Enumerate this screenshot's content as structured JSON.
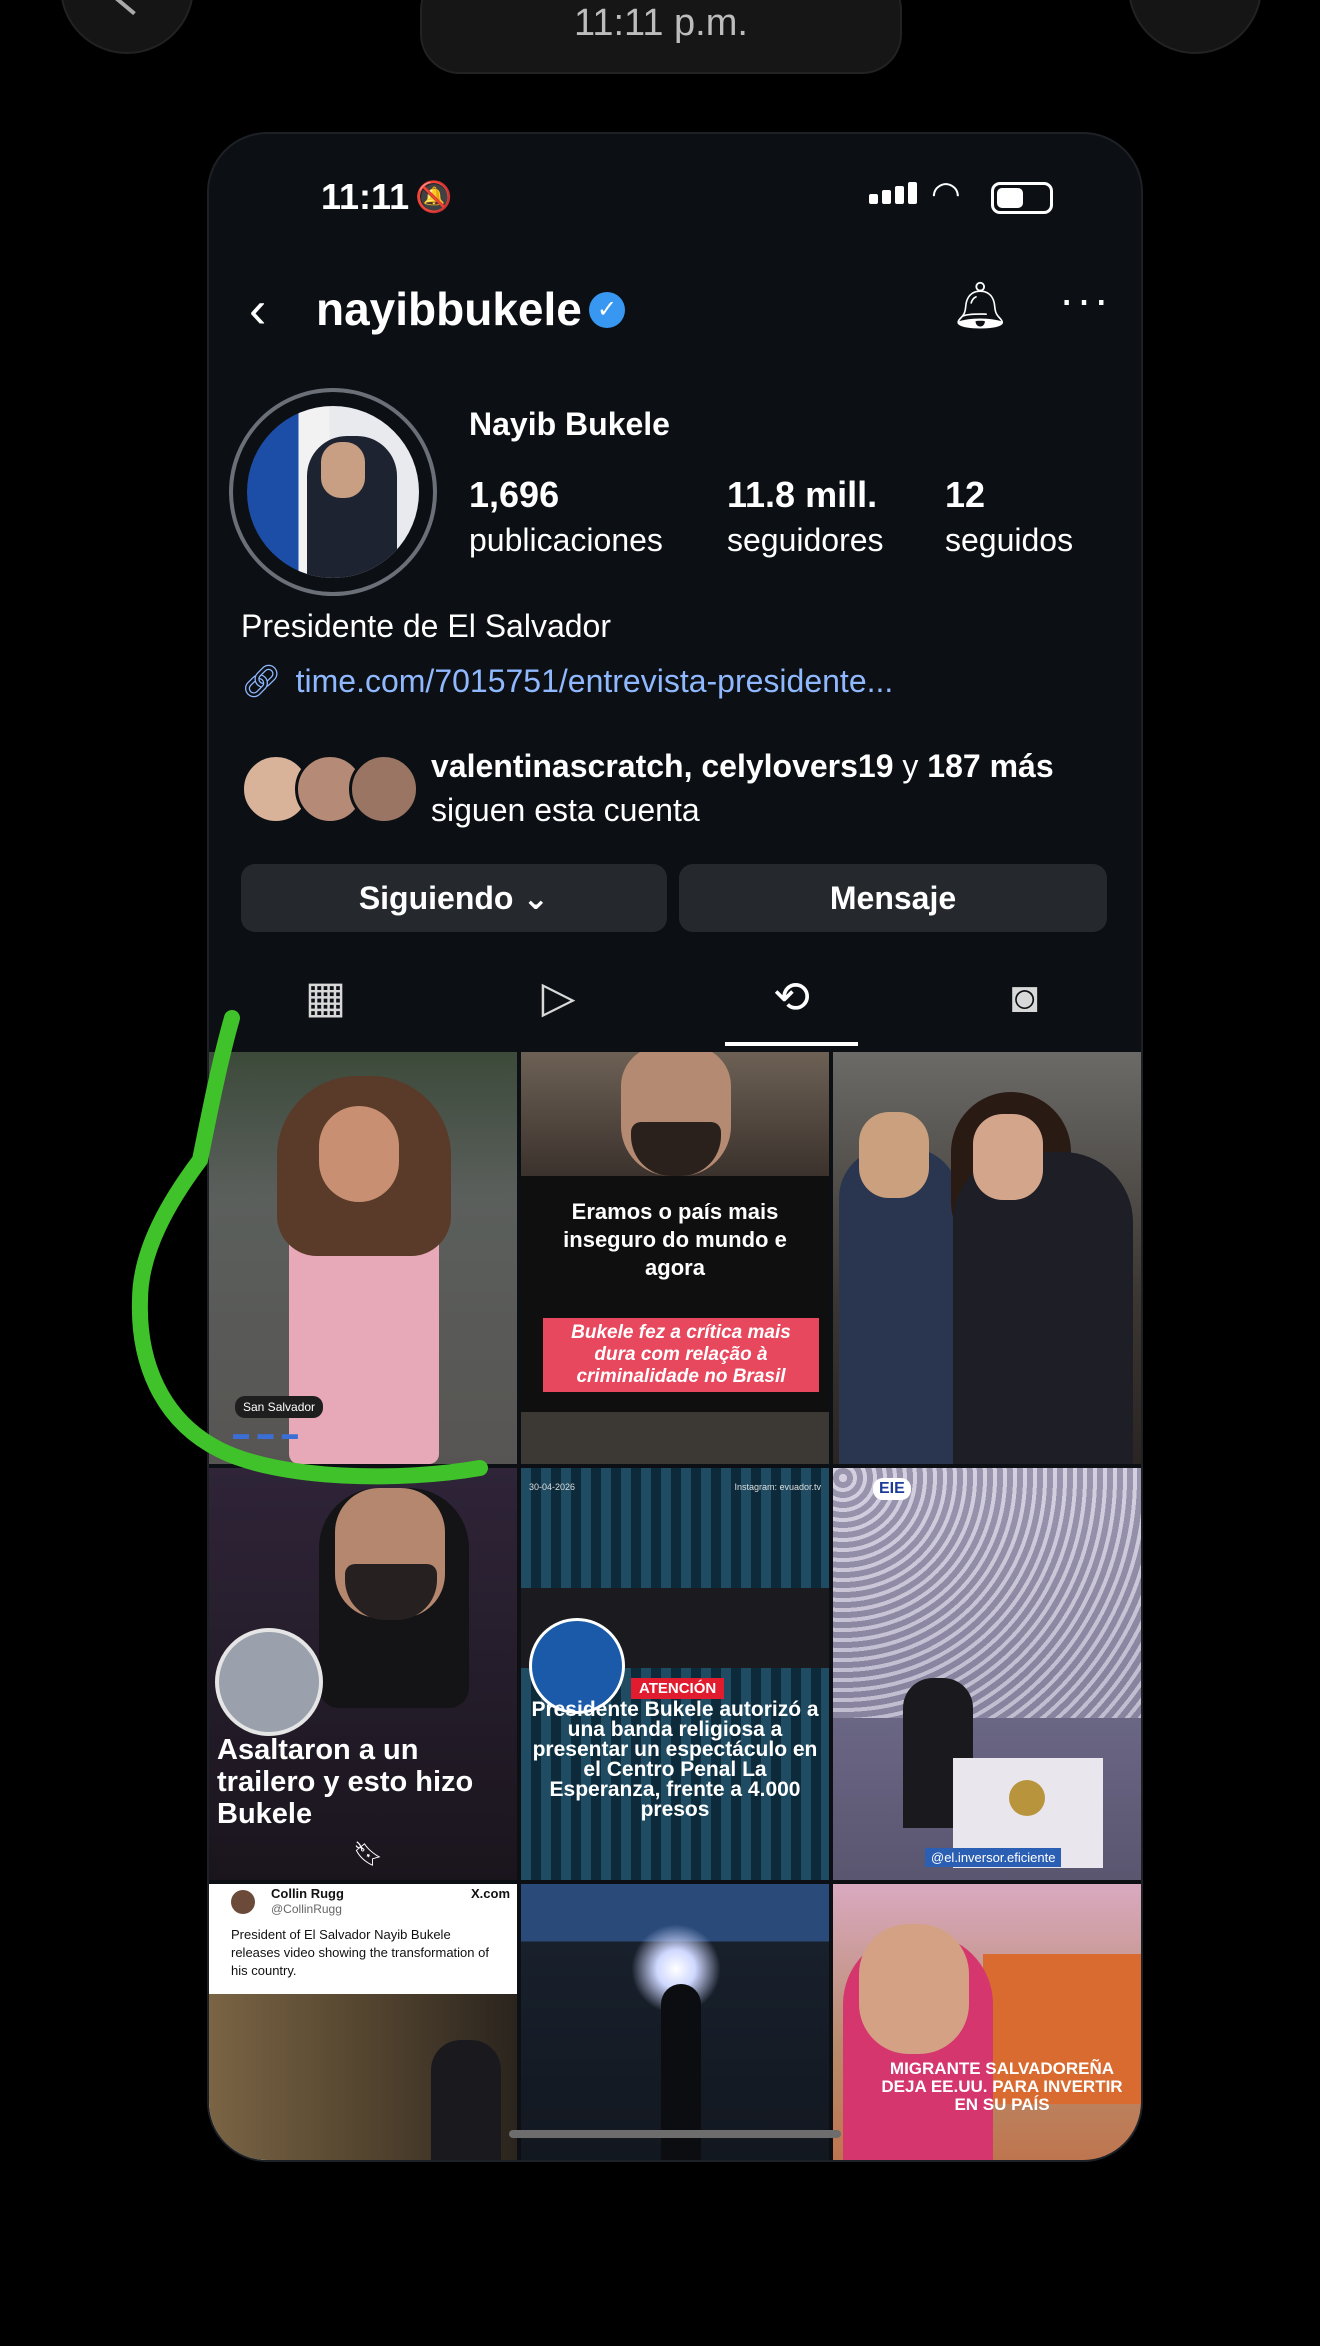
{
  "recording_bar": {
    "time": "11:11 p.m."
  },
  "status_bar": {
    "time": "11:11"
  },
  "header": {
    "username": "nayibbukele",
    "verified_icon": "verified-badge-icon",
    "bell_icon": "bell-icon",
    "more_icon": "more-icon"
  },
  "profile": {
    "name": "Nayib Bukele",
    "posts_count": "1,696",
    "posts_label": "publicaciones",
    "followers_count": "11.8 mill.",
    "followers_label": "seguidores",
    "following_count": "12",
    "following_label": "seguidos",
    "bio": "Presidente de El Salvador",
    "link": "time.com/7015751/entrevista-presidente...",
    "followed_by_names": "valentinascratch, celylovers19",
    "followed_by_and": " y ",
    "followed_by_more": "187 más",
    "followed_by_suffix": "siguen esta cuenta"
  },
  "actions": {
    "following_label": "Siguiendo",
    "message_label": "Mensaje"
  },
  "tabs": [
    {
      "name": "grid",
      "icon": "grid-icon"
    },
    {
      "name": "reels",
      "icon": "reels-icon"
    },
    {
      "name": "reposts",
      "icon": "repost-icon",
      "active": true
    },
    {
      "name": "tagged",
      "icon": "tagged-icon"
    }
  ],
  "posts": {
    "p1_tag": "San Salvador",
    "p2_caption": "Eramos o país mais inseguro do mundo e agora",
    "p2_highlight": "Bukele fez a crítica mais dura com relação à criminalidade no Brasil",
    "p4_caption": "Asaltaron a un trailero y esto hizo Bukele",
    "p5_date": "30-04-2026",
    "p5_source": "Instagram: evuador.tv",
    "p5_alert": "ATENCIÓN",
    "p5_caption": "Presidente Bukele autorizó a una banda religiosa a presentar un espectáculo en el Centro Penal La Esperanza, frente a 4.000 presos",
    "p6_logo": "EIE",
    "p6_handle": "@el.inversor.eficiente",
    "p7_author": "Collin Rugg",
    "p7_handle": "@CollinRugg",
    "p7_platform": "X.com",
    "p7_text": "President of El Salvador Nayib Bukele releases video showing the transformation of his country.",
    "p9_caption": "MIGRANTE SALVADOREÑA DEJA EE.UU. PARA INVERTIR EN SU PAÍS"
  },
  "colors": {
    "background": "#0c1014",
    "link": "#8fb8ff",
    "verified": "#3897f0",
    "annotation": "#3fc22a"
  }
}
